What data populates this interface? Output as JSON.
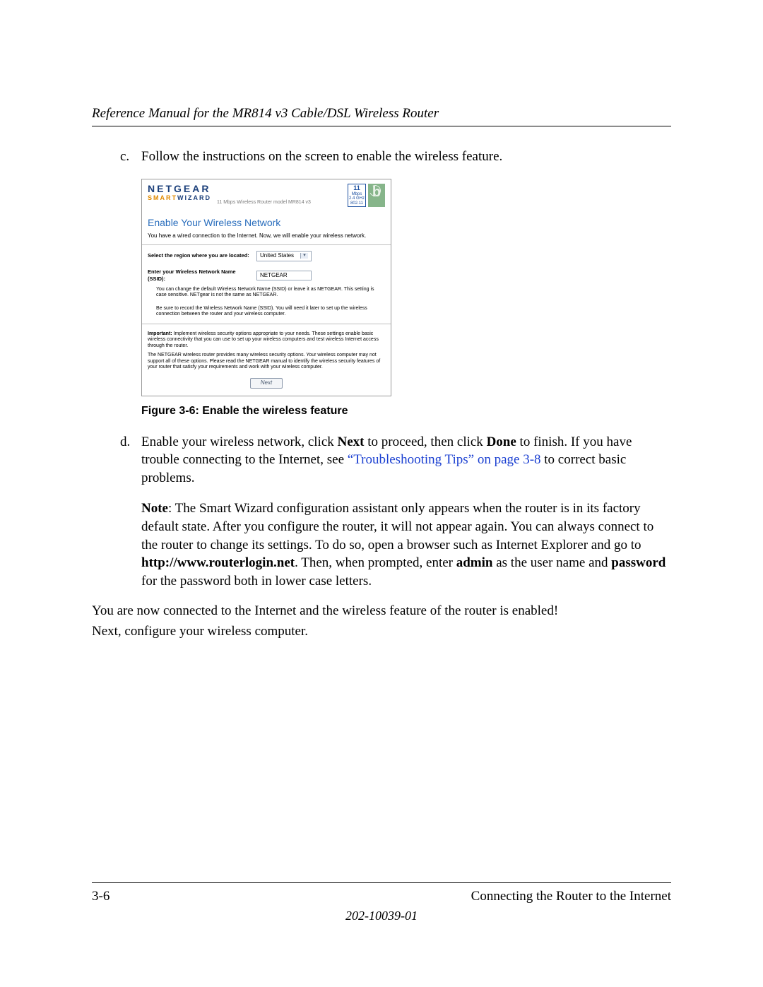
{
  "header": {
    "running_title": "Reference Manual for the MR814 v3 Cable/DSL Wireless Router"
  },
  "steps": {
    "c_marker": "c.",
    "c_text": "Follow the instructions on the screen to enable the wireless feature.",
    "d_marker": "d.",
    "d_pre": "Enable your wireless network, click ",
    "d_next": "Next",
    "d_mid1": " to proceed, then click ",
    "d_done": "Done",
    "d_mid2": " to finish. If you have trouble connecting to the Internet, see ",
    "d_xref": "“Troubleshooting Tips” on page 3-8",
    "d_post": " to correct basic problems."
  },
  "note": {
    "label": "Note",
    "t1": ": The Smart Wizard configuration assistant only appears when the router is in its factory default state. After you configure the router, it will not appear again. You can always connect to the router to change its settings. To do so, open a browser such as Internet Explorer and go to ",
    "url": "http://www.routerlogin.net",
    "t2": ". Then, when prompted, enter ",
    "admin": "admin",
    "t3": " as the user name and ",
    "password": "password",
    "t4": " for the password both in lower case letters."
  },
  "closing": {
    "p1": "You are now connected to the Internet and the wireless feature of the router is enabled!",
    "p2": "Next, configure your wireless computer."
  },
  "figure": {
    "caption": "Figure 3-6:  Enable the wireless feature",
    "brand": "NETGEAR",
    "smart": "SMART",
    "wizard": "WIZARD",
    "model_line": "11 Mbps Wireless Router model MR814 v3",
    "badge1_num": "11",
    "badge1_a": "Mbps",
    "badge1_b": "2.4 GHz",
    "badge1_c": "802.11",
    "badge2": "b",
    "h1": "Enable Your Wireless Network",
    "intro": "You have a wired connection to the Internet. Now, we will enable your wireless network.",
    "region_label": "Select the region where you are located:",
    "region_value": "United States",
    "ssid_label": "Enter your Wireless Network Name (SSID):",
    "ssid_value": "NETGEAR",
    "note1": "You can change the default Wireless Network Name (SSID) or leave it as NETGEAR. This setting is case sensitive. NETgear is not the same as NETGEAR.",
    "note2": "Be sure to record the Wireless Network Name (SSID). You will need it later to set up the wireless connection between the router and your wireless computer.",
    "important_label": "Important:",
    "important1": " Implement wireless security options appropriate to your needs. These settings enable basic wireless connectivity that you can use to set up your wireless computers and test wireless Internet access through the router.",
    "important2": "The NETGEAR wireless router provides many wireless security options. Your wireless computer may not support all of these options. Please read the NETGEAR manual to identify the wireless security features of your router that satisfy your requirements and work with your wireless computer.",
    "next_btn": "Next"
  },
  "footer": {
    "page_num": "3-6",
    "section": "Connecting the Router to the Internet",
    "docnum": "202-10039-01"
  }
}
